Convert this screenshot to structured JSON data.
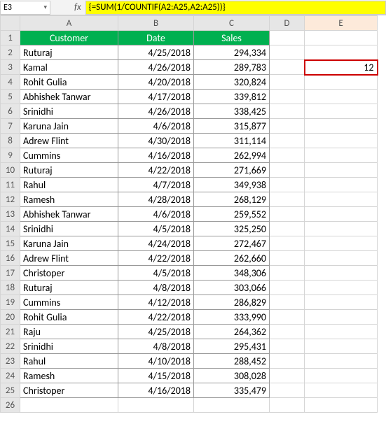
{
  "nameBox": "E3",
  "formula": "{=SUM(1/COUNTIF(A2:A25,A2:A25))}",
  "fxLabel": "fx",
  "columns": [
    "A",
    "B",
    "C",
    "D",
    "E"
  ],
  "headers": {
    "customer": "Customer",
    "date": "Date",
    "sales": "Sales"
  },
  "resultValue": "12",
  "rows": [
    {
      "n": "1"
    },
    {
      "n": "2",
      "customer": "Ruturaj",
      "date": "4/25/2018",
      "sales": "294,334"
    },
    {
      "n": "3",
      "customer": "Kamal",
      "date": "4/26/2018",
      "sales": "289,783"
    },
    {
      "n": "4",
      "customer": "Rohit Gulia",
      "date": "4/20/2018",
      "sales": "320,824"
    },
    {
      "n": "5",
      "customer": "Abhishek Tanwar",
      "date": "4/17/2018",
      "sales": "339,812"
    },
    {
      "n": "6",
      "customer": "Srinidhi",
      "date": "4/26/2018",
      "sales": "338,425"
    },
    {
      "n": "7",
      "customer": "Karuna Jain",
      "date": "4/6/2018",
      "sales": "315,877"
    },
    {
      "n": "8",
      "customer": "Adrew Flint",
      "date": "4/30/2018",
      "sales": "311,114"
    },
    {
      "n": "9",
      "customer": "Cummins",
      "date": "4/16/2018",
      "sales": "262,994"
    },
    {
      "n": "10",
      "customer": "Ruturaj",
      "date": "4/22/2018",
      "sales": "271,669"
    },
    {
      "n": "11",
      "customer": "Rahul",
      "date": "4/7/2018",
      "sales": "349,938"
    },
    {
      "n": "12",
      "customer": "Ramesh",
      "date": "4/28/2018",
      "sales": "268,129"
    },
    {
      "n": "13",
      "customer": "Abhishek Tanwar",
      "date": "4/6/2018",
      "sales": "259,552"
    },
    {
      "n": "14",
      "customer": "Srinidhi",
      "date": "4/5/2018",
      "sales": "325,250"
    },
    {
      "n": "15",
      "customer": "Karuna Jain",
      "date": "4/24/2018",
      "sales": "272,467"
    },
    {
      "n": "16",
      "customer": "Adrew Flint",
      "date": "4/22/2018",
      "sales": "262,660"
    },
    {
      "n": "17",
      "customer": "Christoper",
      "date": "4/5/2018",
      "sales": "348,306"
    },
    {
      "n": "18",
      "customer": "Ruturaj",
      "date": "4/8/2018",
      "sales": "303,066"
    },
    {
      "n": "19",
      "customer": "Cummins",
      "date": "4/12/2018",
      "sales": "286,829"
    },
    {
      "n": "20",
      "customer": "Rohit Gulia",
      "date": "4/22/2018",
      "sales": "333,990"
    },
    {
      "n": "21",
      "customer": "Raju",
      "date": "4/25/2018",
      "sales": "264,362"
    },
    {
      "n": "22",
      "customer": "Srinidhi",
      "date": "4/8/2018",
      "sales": "295,431"
    },
    {
      "n": "23",
      "customer": "Rahul",
      "date": "4/10/2018",
      "sales": "288,452"
    },
    {
      "n": "24",
      "customer": "Ramesh",
      "date": "4/15/2018",
      "sales": "308,028"
    },
    {
      "n": "25",
      "customer": "Christoper",
      "date": "4/16/2018",
      "sales": "335,479"
    },
    {
      "n": "26"
    }
  ],
  "chart_data": {
    "type": "table",
    "title": "Customer Sales",
    "columns": [
      "Customer",
      "Date",
      "Sales"
    ],
    "formula_result": 12,
    "rows": [
      [
        "Ruturaj",
        "4/25/2018",
        294334
      ],
      [
        "Kamal",
        "4/26/2018",
        289783
      ],
      [
        "Rohit Gulia",
        "4/20/2018",
        320824
      ],
      [
        "Abhishek Tanwar",
        "4/17/2018",
        339812
      ],
      [
        "Srinidhi",
        "4/26/2018",
        338425
      ],
      [
        "Karuna Jain",
        "4/6/2018",
        315877
      ],
      [
        "Adrew Flint",
        "4/30/2018",
        311114
      ],
      [
        "Cummins",
        "4/16/2018",
        262994
      ],
      [
        "Ruturaj",
        "4/22/2018",
        271669
      ],
      [
        "Rahul",
        "4/7/2018",
        349938
      ],
      [
        "Ramesh",
        "4/28/2018",
        268129
      ],
      [
        "Abhishek Tanwar",
        "4/6/2018",
        259552
      ],
      [
        "Srinidhi",
        "4/5/2018",
        325250
      ],
      [
        "Karuna Jain",
        "4/24/2018",
        272467
      ],
      [
        "Adrew Flint",
        "4/22/2018",
        262660
      ],
      [
        "Christoper",
        "4/5/2018",
        348306
      ],
      [
        "Ruturaj",
        "4/8/2018",
        303066
      ],
      [
        "Cummins",
        "4/12/2018",
        286829
      ],
      [
        "Rohit Gulia",
        "4/22/2018",
        333990
      ],
      [
        "Raju",
        "4/25/2018",
        264362
      ],
      [
        "Srinidhi",
        "4/8/2018",
        295431
      ],
      [
        "Rahul",
        "4/10/2018",
        288452
      ],
      [
        "Ramesh",
        "4/15/2018",
        308028
      ],
      [
        "Christoper",
        "4/16/2018",
        335479
      ]
    ]
  }
}
